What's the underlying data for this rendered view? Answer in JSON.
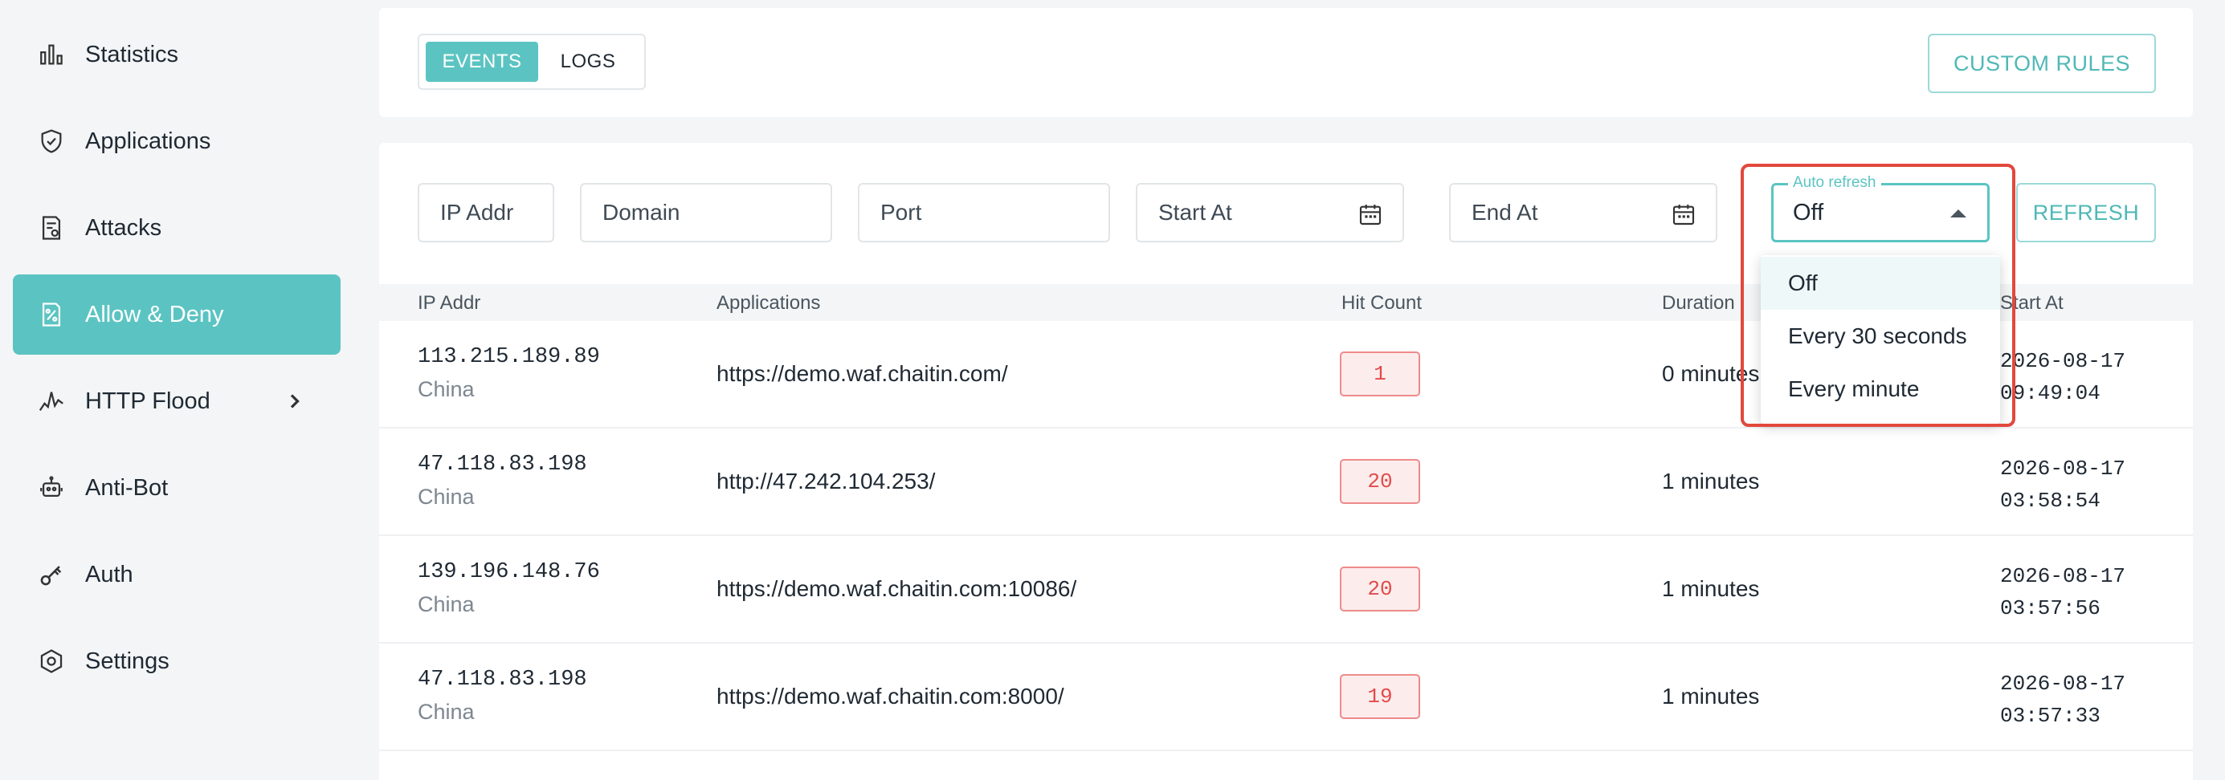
{
  "sidebar": {
    "items": [
      {
        "label": "Statistics",
        "icon": "bar-chart-icon"
      },
      {
        "label": "Applications",
        "icon": "shield-icon"
      },
      {
        "label": "Attacks",
        "icon": "document-icon"
      },
      {
        "label": "Allow & Deny",
        "icon": "percent-doc-icon",
        "active": true
      },
      {
        "label": "HTTP Flood",
        "icon": "pulse-icon"
      },
      {
        "label": "Anti-Bot",
        "icon": "robot-icon"
      },
      {
        "label": "Auth",
        "icon": "key-icon"
      },
      {
        "label": "Settings",
        "icon": "gear-icon"
      }
    ]
  },
  "toolbar": {
    "tab_events": "EVENTS",
    "tab_logs": "LOGS",
    "custom_rules": "CUSTOM RULES"
  },
  "filters": {
    "ip_placeholder": "IP Addr",
    "domain_placeholder": "Domain",
    "port_placeholder": "Port",
    "start_placeholder": "Start At",
    "end_placeholder": "End At",
    "auto_refresh_label": "Auto refresh",
    "auto_refresh_value": "Off",
    "refresh_button": "REFRESH"
  },
  "dropdown": {
    "options": [
      "Off",
      "Every 30 seconds",
      "Every minute"
    ],
    "selected": "Off"
  },
  "table": {
    "headers": [
      "IP Addr",
      "Applications",
      "Hit Count",
      "Duration",
      "Start At"
    ],
    "rows": [
      {
        "ip": "113.215.189.89",
        "country": "China",
        "app": "https://demo.waf.chaitin.com/",
        "hits": "1",
        "duration": "0 minutes",
        "date": "2026-08-17",
        "time": "09:49:04"
      },
      {
        "ip": "47.118.83.198",
        "country": "China",
        "app": "http://47.242.104.253/",
        "hits": "20",
        "duration": "1 minutes",
        "date": "2026-08-17",
        "time": "03:58:54"
      },
      {
        "ip": "139.196.148.76",
        "country": "China",
        "app": "https://demo.waf.chaitin.com:10086/",
        "hits": "20",
        "duration": "1 minutes",
        "date": "2026-08-17",
        "time": "03:57:56"
      },
      {
        "ip": "47.118.83.198",
        "country": "China",
        "app": "https://demo.waf.chaitin.com:8000/",
        "hits": "19",
        "duration": "1 minutes",
        "date": "2026-08-17",
        "time": "03:57:33"
      }
    ]
  },
  "colors": {
    "accent": "#5bc4c2",
    "highlight": "#e2483c",
    "hit_badge": "#e24b4b"
  }
}
